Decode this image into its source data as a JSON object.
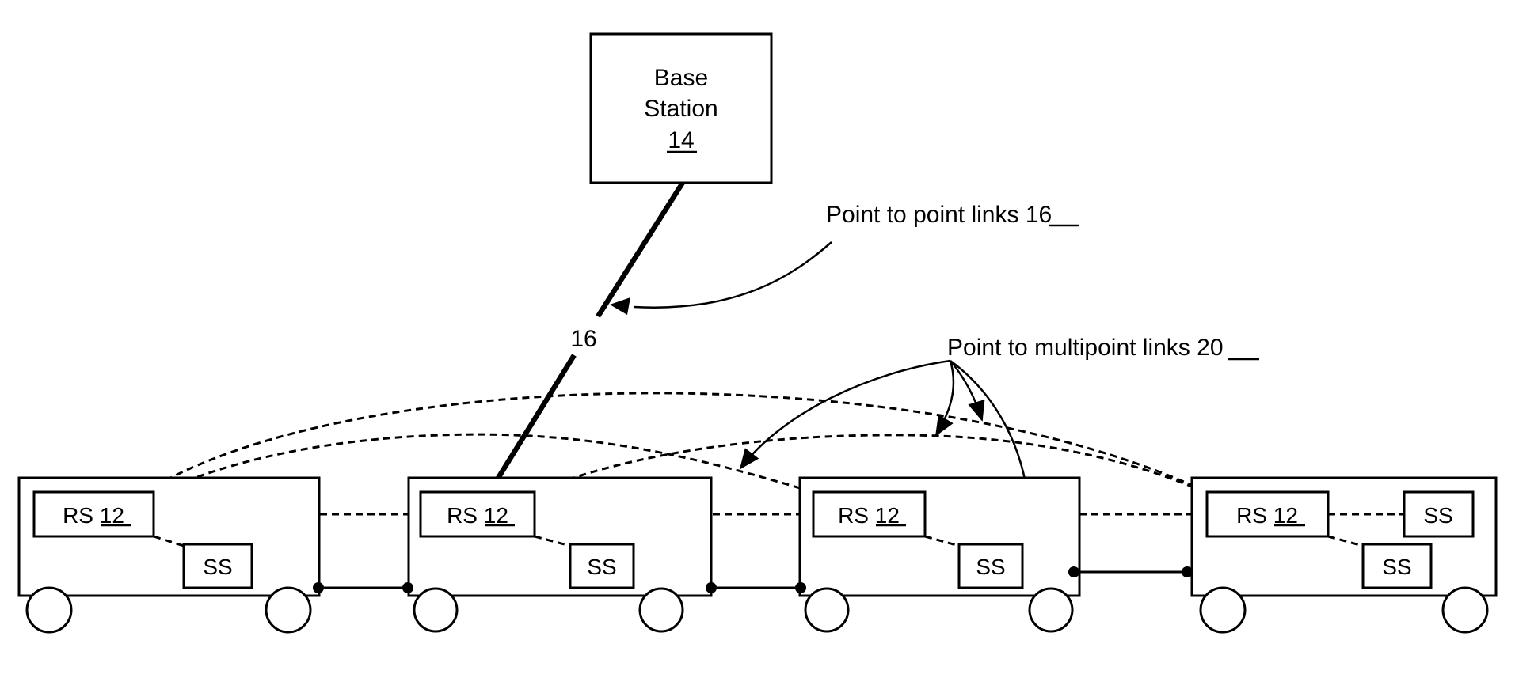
{
  "diagram": {
    "base_station": {
      "line1": "Base",
      "line2": "Station",
      "ref": "14"
    },
    "p2p_link_label": "16",
    "callouts": {
      "p2p": {
        "text": "Point to point links ",
        "ref": "16"
      },
      "p2mp": {
        "text": "Point to multipoint links ",
        "ref": "20"
      }
    },
    "cars": [
      {
        "rs": {
          "text": "RS ",
          "ref": "12"
        },
        "ss": [
          "SS"
        ]
      },
      {
        "rs": {
          "text": "RS ",
          "ref": "12"
        },
        "ss": [
          "SS"
        ]
      },
      {
        "rs": {
          "text": "RS ",
          "ref": "12"
        },
        "ss": [
          "SS"
        ]
      },
      {
        "rs": {
          "text": "RS ",
          "ref": "12"
        },
        "ss": [
          "SS",
          "SS"
        ]
      }
    ],
    "colors": {
      "ink": "#000000",
      "background": "#ffffff"
    }
  }
}
